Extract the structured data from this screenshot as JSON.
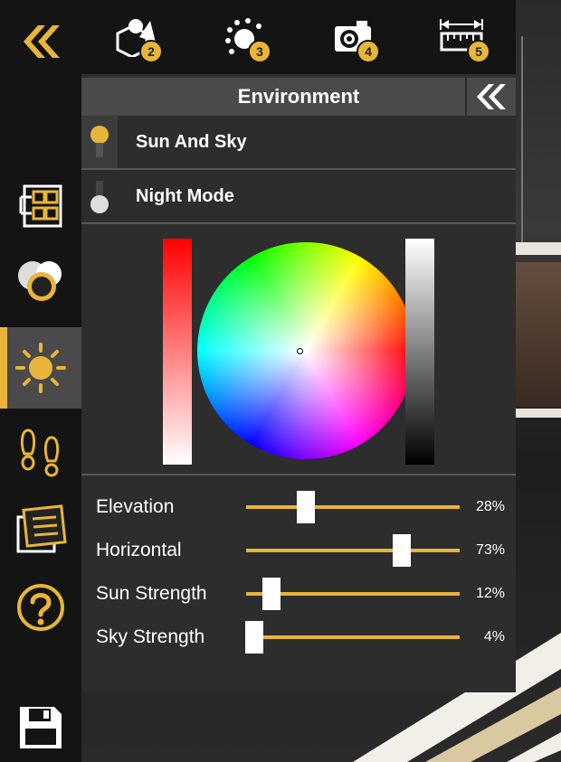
{
  "rail": {
    "items": [
      {
        "name": "collapse-all",
        "icon": "double-chevron-left-icon"
      },
      {
        "name": "layers",
        "icon": "layout-tree-icon"
      },
      {
        "name": "materials",
        "icon": "material-spheres-icon"
      },
      {
        "name": "environment",
        "icon": "sun-icon",
        "active": true
      },
      {
        "name": "walk",
        "icon": "footprints-icon"
      },
      {
        "name": "notes",
        "icon": "notes-icon"
      },
      {
        "name": "help",
        "icon": "help-icon"
      },
      {
        "name": "save",
        "icon": "floppy-disk-icon"
      }
    ]
  },
  "toolbar": {
    "buttons": [
      {
        "icon": "objects-icon",
        "badge": "2"
      },
      {
        "icon": "orbit-icon",
        "badge": "3"
      },
      {
        "icon": "camera-icon",
        "badge": "4"
      },
      {
        "icon": "measure-icon",
        "badge": "5"
      }
    ]
  },
  "panel": {
    "title": "Environment",
    "modes": [
      {
        "label": "Sun And Sky",
        "active": true
      },
      {
        "label": "Night Mode",
        "active": false
      }
    ],
    "sliders": [
      {
        "label": "Elevation",
        "value": 28,
        "display": "28%"
      },
      {
        "label": "Horizontal",
        "value": 73,
        "display": "73%"
      },
      {
        "label": "Sun Strength",
        "value": 12,
        "display": "12%"
      },
      {
        "label": "Sky Strength",
        "value": 4,
        "display": "4%"
      }
    ]
  },
  "colors": {
    "accent": "#e8b53a",
    "panel": "#2d2d2d",
    "header": "#4a4a4a"
  }
}
